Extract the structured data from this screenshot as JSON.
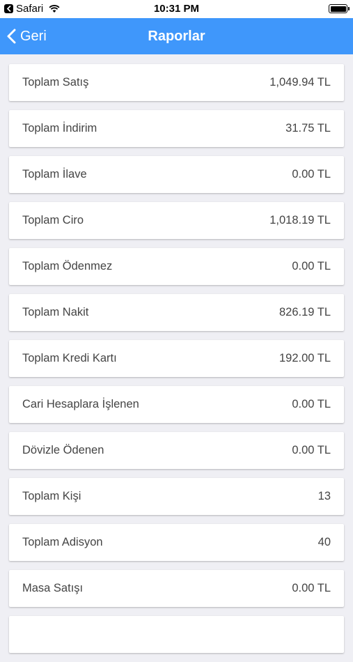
{
  "status_bar": {
    "app_back_label": "Safari",
    "time": "10:31 PM"
  },
  "nav": {
    "back_label": "Geri",
    "title": "Raporlar",
    "bar_color": "#3f97fb"
  },
  "report_rows": [
    {
      "label": "Toplam Satış",
      "value": "1,049.94 TL"
    },
    {
      "label": "Toplam İndirim",
      "value": "31.75 TL"
    },
    {
      "label": "Toplam İlave",
      "value": "0.00 TL"
    },
    {
      "label": "Toplam Ciro",
      "value": "1,018.19 TL"
    },
    {
      "label": "Toplam Ödenmez",
      "value": "0.00 TL"
    },
    {
      "label": "Toplam Nakit",
      "value": "826.19 TL"
    },
    {
      "label": "Toplam Kredi Kartı",
      "value": "192.00 TL"
    },
    {
      "label": "Cari Hesaplara İşlenen",
      "value": "0.00 TL"
    },
    {
      "label": "Dövizle Ödenen",
      "value": "0.00 TL"
    },
    {
      "label": "Toplam Kişi",
      "value": "13"
    },
    {
      "label": "Toplam Adisyon",
      "value": "40"
    },
    {
      "label": "Masa Satışı",
      "value": "0.00 TL"
    },
    {
      "label": "",
      "value": ""
    }
  ]
}
